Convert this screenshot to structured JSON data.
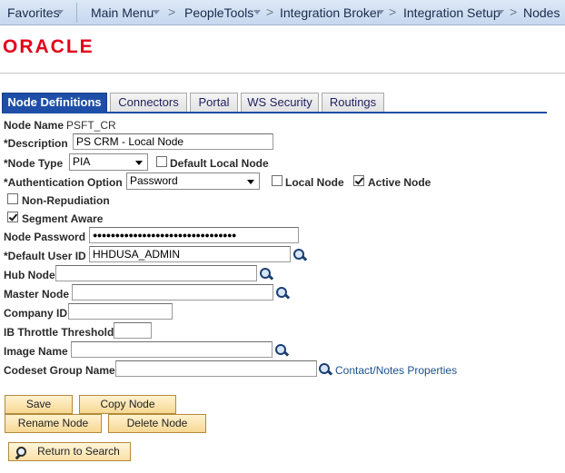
{
  "breadcrumb": {
    "items": [
      "Favorites",
      "Main Menu",
      "PeopleTools",
      "Integration Broker",
      "Integration Setup",
      "Nodes"
    ]
  },
  "logo": {
    "text": "ORACLE",
    "color": "#e2001a"
  },
  "tabs": [
    {
      "label": "Node Definitions",
      "active": true
    },
    {
      "label": "Connectors",
      "active": false
    },
    {
      "label": "Portal",
      "active": false
    },
    {
      "label": "WS Security",
      "active": false
    },
    {
      "label": "Routings",
      "active": false
    }
  ],
  "form": {
    "node_name": {
      "label": "Node Name",
      "value": "PSFT_CR"
    },
    "description": {
      "label": "*Description",
      "value": "PS CRM - Local Node"
    },
    "node_type": {
      "label": "*Node Type",
      "value": "PIA"
    },
    "default_local_node": {
      "label": "Default Local Node",
      "checked": false
    },
    "authentication_option": {
      "label": "*Authentication Option",
      "value": "Password"
    },
    "local_node": {
      "label": "Local Node",
      "checked": false
    },
    "active_node": {
      "label": "Active Node",
      "checked": true
    },
    "non_repudiation": {
      "label": "Non-Repudiation",
      "checked": false
    },
    "segment_aware": {
      "label": "Segment Aware",
      "checked": true
    },
    "node_password": {
      "label": "Node Password",
      "value": "●●●●●●●●●●●●●●●●●●●●●●●●●●●●●●●●"
    },
    "default_user_id": {
      "label": "*Default User ID",
      "value": "HHDUSA_ADMIN"
    },
    "hub_node": {
      "label": "Hub Node",
      "value": ""
    },
    "master_node": {
      "label": "Master Node",
      "value": ""
    },
    "company_id": {
      "label": "Company ID",
      "value": ""
    },
    "ib_throttle_threshold": {
      "label": "IB Throttle Threshold",
      "value": ""
    },
    "image_name": {
      "label": "Image Name",
      "value": ""
    },
    "codeset_group_name": {
      "label": "Codeset Group Name",
      "value": ""
    },
    "contact_notes_link": "Contact/Notes Properties"
  },
  "buttons": {
    "save": "Save",
    "copy_node": "Copy Node",
    "rename_node": "Rename Node",
    "delete_node": "Delete Node",
    "return_to_search": "Return to Search"
  },
  "colors": {
    "active_tab": "#1e4fa8",
    "link": "#1a4f8f",
    "button": "#f7d894"
  }
}
